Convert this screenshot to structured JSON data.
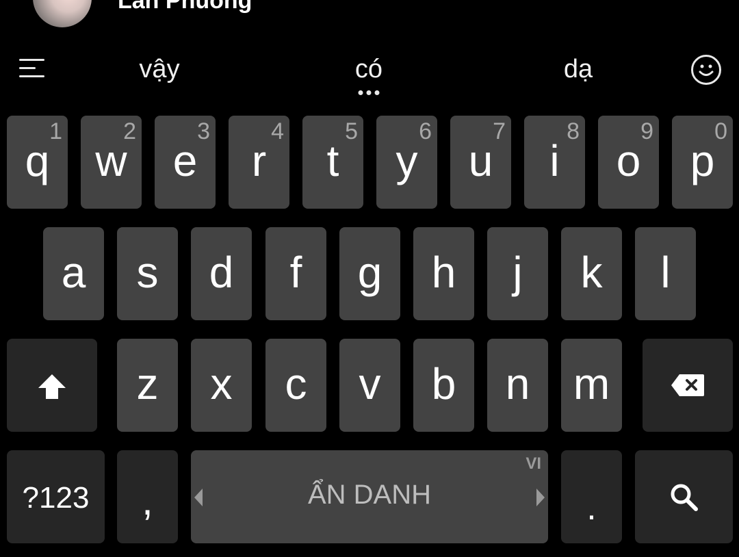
{
  "contact": {
    "name": "Lan Phuong",
    "avatar_icon": "profile-photo"
  },
  "suggestions": {
    "menu_icon": "menu-icon",
    "left": "vậy",
    "center": "có",
    "right": "dạ",
    "emoji_icon": "smiley-icon"
  },
  "keyboard": {
    "row1": [
      {
        "letter": "q",
        "hint": "1"
      },
      {
        "letter": "w",
        "hint": "2"
      },
      {
        "letter": "e",
        "hint": "3"
      },
      {
        "letter": "r",
        "hint": "4"
      },
      {
        "letter": "t",
        "hint": "5"
      },
      {
        "letter": "y",
        "hint": "6"
      },
      {
        "letter": "u",
        "hint": "7"
      },
      {
        "letter": "i",
        "hint": "8"
      },
      {
        "letter": "o",
        "hint": "9"
      },
      {
        "letter": "p",
        "hint": "0"
      }
    ],
    "row2": [
      "a",
      "s",
      "d",
      "f",
      "g",
      "h",
      "j",
      "k",
      "l"
    ],
    "row3": [
      "z",
      "x",
      "c",
      "v",
      "b",
      "n",
      "m"
    ],
    "shift_icon": "shift-arrow-icon",
    "backspace_icon": "backspace-icon",
    "symbols_label": "?123",
    "comma_label": ",",
    "space_label": "ẨN DANH",
    "language_badge": "VI",
    "period_label": ".",
    "search_icon": "search-icon"
  },
  "colors": {
    "background": "#000000",
    "key": "#434343",
    "function_key": "#262626",
    "text": "#ffffff",
    "hint": "#a8a8a8"
  }
}
